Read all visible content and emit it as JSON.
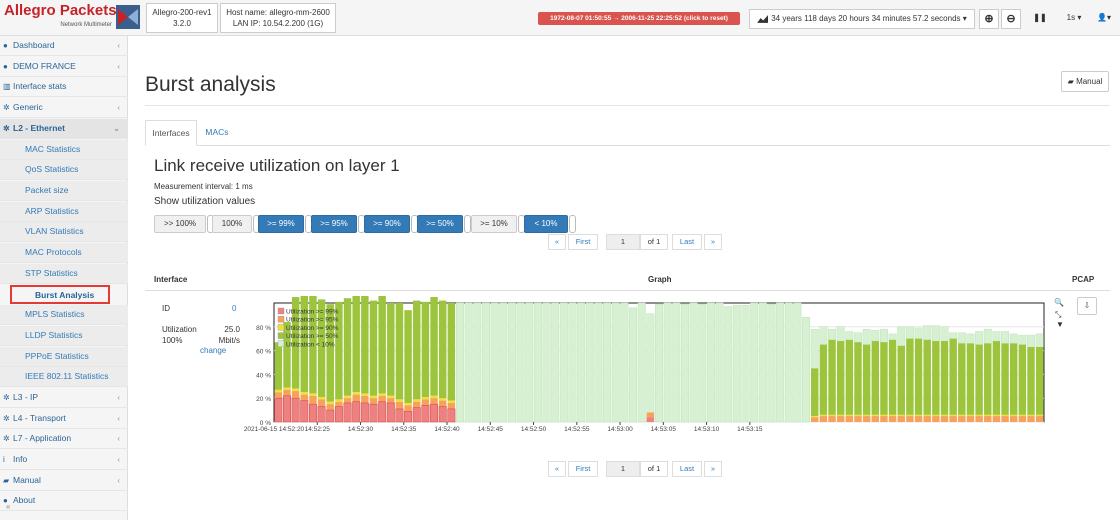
{
  "header": {
    "brand_title": "Allegro Packets",
    "brand_sub": "Network Multimeter",
    "device": [
      "Allegro-200-rev1",
      "3.2.0"
    ],
    "host": [
      "Host name: allegro-mm-2600",
      "LAN IP: 10.54.2.200 (1G)"
    ],
    "time_range": "1972-08-07 01:50:55 → 2006-11-25 22:25:52 (click to reset)",
    "duration": "34 years 118 days 20 hours 34 minutes 57.2 seconds ▾",
    "interval": "1s ▾",
    "user": "▾"
  },
  "sidebar": {
    "items": [
      {
        "label": "Dashboard",
        "icon": "dashboard-icon",
        "glyph": "●",
        "chev": "‹"
      },
      {
        "label": "DEMO FRANCE",
        "icon": "dashboard-icon",
        "glyph": "●",
        "chev": "‹"
      },
      {
        "label": "Interface stats",
        "icon": "chart-icon",
        "glyph": "▥",
        "chev": ""
      },
      {
        "label": "Generic",
        "icon": "gear-icon",
        "glyph": "✲",
        "chev": "‹"
      },
      {
        "label": "L2 - Ethernet",
        "icon": "gear-icon",
        "glyph": "✲",
        "chev": "⌄"
      }
    ],
    "sub_items": [
      "MAC Statistics",
      "QoS Statistics",
      "Packet size",
      "ARP Statistics",
      "VLAN Statistics",
      "MAC Protocols",
      "STP Statistics",
      "Burst Analysis",
      "MPLS Statistics",
      "LLDP Statistics",
      "PPPoE Statistics",
      "IEEE 802.11 Statistics"
    ],
    "bottom_items": [
      {
        "label": "L3 - IP",
        "icon": "gear-icon",
        "glyph": "✲",
        "chev": "‹"
      },
      {
        "label": "L4 - Transport",
        "icon": "gear-icon",
        "glyph": "✲",
        "chev": "‹"
      },
      {
        "label": "L7 - Application",
        "icon": "gear-icon",
        "glyph": "✲",
        "chev": "‹"
      },
      {
        "label": "Info",
        "icon": "info-icon",
        "glyph": "i",
        "chev": "‹"
      },
      {
        "label": "Manual",
        "icon": "book-icon",
        "glyph": "▰",
        "chev": "‹"
      },
      {
        "label": "About",
        "icon": "info-circle-icon",
        "glyph": "●",
        "chev": ""
      }
    ],
    "collapse": "«"
  },
  "page": {
    "title": "Burst analysis",
    "manual": "Manual",
    "tabs": [
      "Interfaces",
      "MACs"
    ],
    "subtitle": "Link receive utilization on layer 1",
    "measurement": "Measurement interval:  1 ms",
    "show_label": "Show utilization values"
  },
  "filters": [
    ">> 100%",
    "100%",
    ">= 99%",
    ">= 95%",
    ">= 90%",
    ">= 50%",
    ">= 10%",
    "< 10%"
  ],
  "pagination": {
    "prev": "«",
    "first": "First",
    "page": "1",
    "of": "of 1",
    "last": "Last",
    "next": "»"
  },
  "table": {
    "headers": {
      "interface": "Interface",
      "graph": "Graph",
      "pcap": "PCAP"
    },
    "id_label": "ID",
    "id_value": "0",
    "util_label": "Utilization 100%",
    "util_value": "25.0 Mbit/s",
    "change": "change"
  },
  "colors": {
    "u99": "#ef8080",
    "u95": "#f6a25a",
    "u90": "#f2df3a",
    "u50": "#9cc43d",
    "u10": "#d7f0d2"
  },
  "chart_data": {
    "type": "bar",
    "legend": [
      "Utilization >= 99%",
      "Utilization >= 95%",
      "Utilization >= 90%",
      "Utilization >= 50%",
      "Utilization < 10%"
    ],
    "yticks": [
      "0 %",
      "20 %",
      "40 %",
      "60 %",
      "80 %"
    ],
    "ylim": [
      0,
      100
    ],
    "x_start_label": "2021-06-15 14:52:20",
    "xticks": [
      "14:52:25",
      "14:52:30",
      "14:52:35",
      "14:52:40",
      "14:52:45",
      "14:52:50",
      "14:52:55",
      "14:53:00",
      "14:53:05",
      "14:53:10",
      "14:53:15"
    ],
    "total": [
      46,
      55,
      77,
      81,
      82,
      82,
      82,
      82,
      82,
      83,
      82,
      80,
      83,
      78,
      81,
      78,
      83,
      80,
      83,
      82,
      82,
      100,
      100,
      100,
      100,
      100,
      100,
      100,
      100,
      100,
      100,
      100,
      100,
      100,
      100,
      100,
      100,
      100,
      100,
      100,
      100,
      96,
      100,
      91,
      99,
      100,
      100,
      99,
      100,
      99,
      100,
      100,
      97,
      98,
      98,
      100,
      100,
      99,
      100,
      100,
      100,
      88,
      78,
      80,
      78,
      80,
      76,
      75,
      78,
      77,
      78,
      74,
      80,
      80,
      79,
      81,
      81,
      80,
      75,
      75,
      74,
      76,
      78,
      76,
      76,
      74,
      73,
      73,
      74
    ],
    "u50": [
      40,
      55,
      77,
      81,
      82,
      82,
      82,
      82,
      82,
      83,
      82,
      80,
      83,
      78,
      81,
      78,
      83,
      80,
      83,
      82,
      82,
      0,
      0,
      0,
      0,
      0,
      0,
      0,
      0,
      0,
      0,
      0,
      0,
      0,
      0,
      0,
      0,
      0,
      0,
      0,
      0,
      0,
      0,
      0,
      0,
      0,
      0,
      0,
      0,
      0,
      0,
      0,
      0,
      0,
      0,
      0,
      0,
      0,
      0,
      0,
      0,
      0,
      40,
      59,
      63,
      62,
      63,
      61,
      59,
      62,
      61,
      63,
      58,
      64,
      64,
      63,
      62,
      62,
      64,
      60,
      60,
      59,
      60,
      62,
      60,
      60,
      59,
      57,
      57,
      58
    ],
    "u90": [
      2,
      2,
      2,
      2,
      2,
      2,
      2,
      2,
      2,
      2,
      2,
      2,
      2,
      2,
      2,
      2,
      2,
      2,
      2,
      2,
      2,
      0,
      0,
      0,
      0,
      0,
      0,
      0,
      0,
      0,
      0,
      0,
      0,
      0,
      0,
      0,
      0,
      0,
      0,
      0,
      0,
      0,
      0,
      0,
      0,
      0,
      0,
      0,
      0,
      0,
      0,
      0,
      0,
      0,
      0,
      0,
      0,
      0,
      0,
      0,
      0,
      0,
      1,
      1,
      1,
      1,
      1,
      1,
      1,
      1,
      1,
      1,
      1,
      1,
      1,
      1,
      1,
      1,
      1,
      1,
      1,
      1,
      1,
      1,
      1,
      1,
      1,
      1,
      1
    ],
    "u95": [
      5,
      5,
      6,
      5,
      7,
      6,
      5,
      4,
      4,
      6,
      6,
      5,
      5,
      4,
      6,
      5,
      5,
      5,
      5,
      5,
      5,
      0,
      0,
      0,
      0,
      0,
      0,
      0,
      0,
      0,
      0,
      0,
      0,
      0,
      0,
      0,
      0,
      0,
      0,
      0,
      0,
      0,
      0,
      0,
      0,
      0,
      0,
      0,
      0,
      0,
      0,
      0,
      0,
      0,
      0,
      0,
      0,
      0,
      0,
      0,
      0,
      0,
      4,
      5,
      5,
      5,
      5,
      5,
      5,
      5,
      5,
      5,
      5,
      5,
      5,
      5,
      5,
      5,
      5,
      5,
      5,
      5,
      5,
      5,
      5,
      5,
      5,
      5,
      5
    ],
    "u99": [
      20,
      22,
      20,
      18,
      15,
      13,
      10,
      13,
      16,
      17,
      16,
      15,
      17,
      16,
      11,
      9,
      12,
      14,
      15,
      13,
      11,
      0,
      0,
      0,
      0,
      0,
      0,
      0,
      0,
      0,
      0,
      0,
      0,
      0,
      0,
      0,
      0,
      0,
      0,
      0,
      0,
      0,
      0,
      0,
      0,
      0,
      0,
      0,
      0,
      0,
      0,
      0,
      0,
      0,
      0,
      0,
      0,
      0,
      0,
      0,
      0,
      0,
      0,
      0,
      0,
      0,
      0,
      0,
      0,
      0,
      0,
      0,
      0,
      0,
      0,
      0,
      0,
      0,
      0,
      0,
      0,
      0,
      0,
      0,
      0,
      0,
      0,
      0,
      0
    ],
    "isolated": [
      {
        "index": 43,
        "u95": 4,
        "u99": 4
      }
    ],
    "grid": true,
    "legend_position": "top-left"
  }
}
